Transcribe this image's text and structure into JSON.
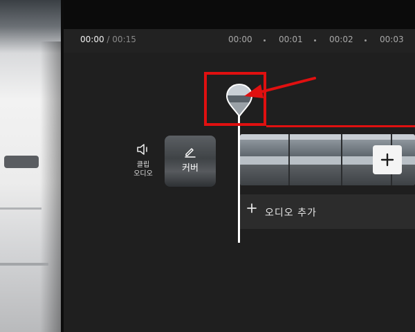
{
  "timecode": {
    "current": "00:00",
    "separator": "/",
    "duration": "00:15"
  },
  "ruler": {
    "ticks": [
      "00:00",
      "00:01",
      "00:02",
      "00:03"
    ]
  },
  "clip_audio": {
    "label_line1": "클립",
    "label_line2": "오디오",
    "icon": "speaker-icon"
  },
  "cover": {
    "label": "커버",
    "icon": "pencil-icon"
  },
  "audio_track": {
    "label": "오디오 추가",
    "icon": "plus-icon"
  },
  "add_clip": {
    "icon": "plus-icon"
  },
  "annotation": {
    "color": "#e01010"
  }
}
